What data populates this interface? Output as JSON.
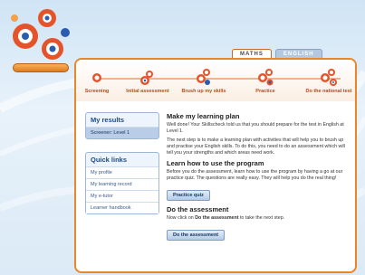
{
  "subject_tabs": [
    "MATHS",
    "ENGLISH"
  ],
  "steps": [
    "Screening",
    "Initial assessment",
    "Brush up my skills",
    "Practice",
    "Do the national test"
  ],
  "sidebar": {
    "results_title": "My results",
    "results_items": [
      "Screener: Level 1"
    ],
    "links_title": "Quick links",
    "links_items": [
      "My profile",
      "My learning record",
      "My e-tutor",
      "Learner handbook"
    ]
  },
  "main": {
    "plan_title": "Make my learning plan",
    "plan_p1": "Well done! Your Skillscheck told us that you should prepare for the test in English at Level 1.",
    "plan_p2": "The next step is to make a learning plan with activities that will help you to brush up and practise your English skills. To do this, you need to do an assessment which will tell you your strengths and which areas need work.",
    "learn_title": "Learn how to use the program",
    "learn_p": "Before you do the assessment, learn how to use the program by having a go at our practice quiz. The questions are really easy. They will help you do the real thing!",
    "practice_btn": "Practice quiz",
    "assess_title": "Do the assessment",
    "assess_p_pre": "Now click on ",
    "assess_p_bold": "Do the assessment",
    "assess_p_post": " to take the next step.",
    "assess_btn": "Do the assessment"
  },
  "colors": {
    "accent": "#e9862a",
    "step_label": "#c04a12",
    "link": "#1d4a8a"
  },
  "icons": [
    "logo-circles-icon",
    "step-target-icon"
  ]
}
